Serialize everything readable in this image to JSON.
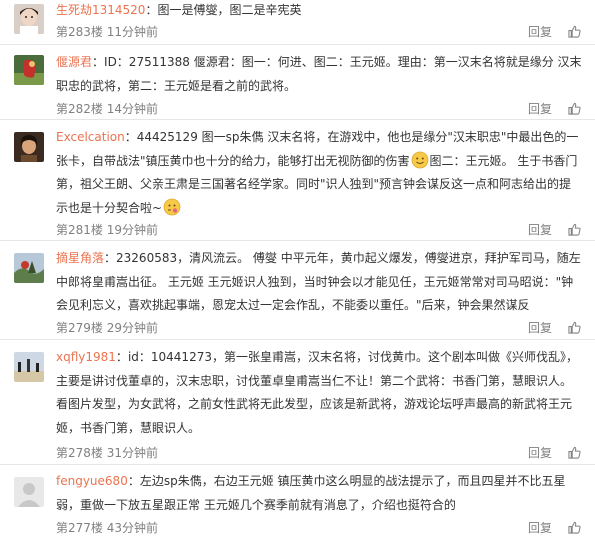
{
  "comments": [
    {
      "username": "生死劫1314520",
      "colon": "：",
      "segments": [
        "图一是傅燮，图二是辛宪英"
      ],
      "floor": "第283楼",
      "time": "11分钟前",
      "reply_label": "回复",
      "like_count": "",
      "avatar": "avatar-1"
    },
    {
      "username": "偃源君",
      "colon": "：",
      "segments": [
        "ID：27511388 偃源君：图一：何进、图二：王元姬。理由：第一汉末名将就是缘分 汉末职忠的武将，第二：王元姬是看之前的武将。"
      ],
      "floor": "第282楼",
      "time": "14分钟前",
      "reply_label": "回复",
      "like_count": "",
      "avatar": "avatar-2"
    },
    {
      "username": "Excelcation",
      "colon": "：",
      "segments": [
        "44425129 图一sp朱儁 汉末名将，在游戏中，他也是缘分\"汉末职忠\"中最出色的一张卡，自带战法\"镇压黄巾也十分的给力，能够打出无视防御的伤害",
        "图二：王元姬。 生于书香门第，祖父王朗、父亲王肃是三国著名经学家。同时\"识人独到\"预言钟会谋反这一点和阿志给出的提示也是十分契合啦~"
      ],
      "emojis": [
        "smile",
        "think"
      ],
      "floor": "第281楼",
      "time": "19分钟前",
      "reply_label": "回复",
      "like_count": "",
      "avatar": "avatar-3"
    },
    {
      "username": "摘星角落",
      "colon": "：",
      "segments": [
        "23260583，清风流云。 傅燮 中平元年，黄巾起义爆发，傅燮进京，拜护军司马，随左中郎将皇甫嵩出征。 王元姬 王元姬识人独到，当时钟会以才能见任，王元姬常常对司马昭说：\"钟会见利忘义，喜欢挑起事端，恩宠太过一定会作乱，不能委以重任。\"后来，钟会果然谋反"
      ],
      "floor": "第279楼",
      "time": "29分钟前",
      "reply_label": "回复",
      "like_count": "",
      "avatar": "avatar-4"
    },
    {
      "username": "xqfly1981",
      "colon": "：",
      "segments": [
        "id：10441273，第一张皇甫嵩，汉末名将，讨伐黄巾。这个剧本叫做《兴师伐乱》，主要是讲讨伐董卓的，汉末忠职，讨伐董卓皇甫嵩当仁不让！第二个武将：书香门第，慧眼识人。看图片发型，为女武将，之前女性武将无此发型，应该是新武将，游戏论坛呼声最高的新武将王元姬，书香门第，慧眼识人。"
      ],
      "floor": "第278楼",
      "time": "31分钟前",
      "reply_label": "回复",
      "like_count": "",
      "avatar": "avatar-5"
    },
    {
      "username": "fengyue680",
      "colon": "：",
      "segments": [
        "左边sp朱儁，右边王元姬 镇压黄巾这么明显的战法提示了，而且四星并不比五星弱，重做一下放五星跟正常 王元姬几个赛季前就有消息了，介绍也挺符合的"
      ],
      "floor": "第277楼",
      "time": "43分钟前",
      "reply_label": "回复",
      "like_count": "",
      "avatar": "avatar-6"
    }
  ]
}
